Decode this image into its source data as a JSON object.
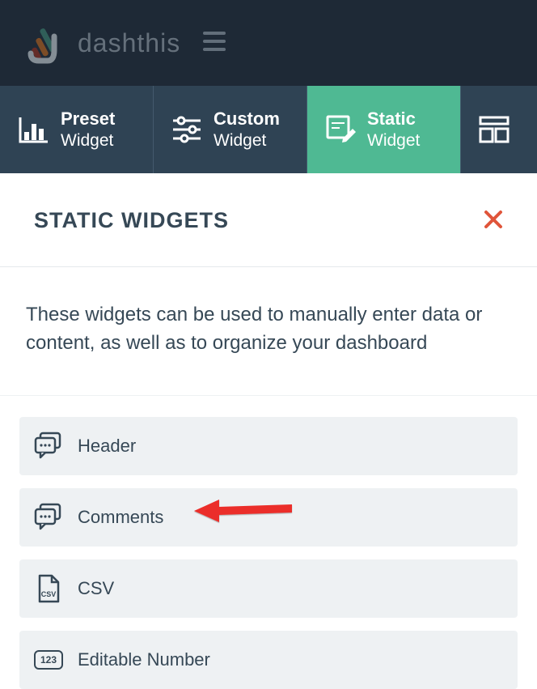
{
  "brand": {
    "name": "dashthis"
  },
  "tabs": [
    {
      "title": "Preset",
      "sub": "Widget"
    },
    {
      "title": "Custom",
      "sub": "Widget"
    },
    {
      "title": "Static",
      "sub": "Widget",
      "active": true
    }
  ],
  "panel": {
    "title": "STATIC WIDGETS",
    "description": "These widgets can be used to manually enter data or content, as well as to organize your dashboard"
  },
  "widgets": [
    {
      "label": "Header",
      "icon": "comment"
    },
    {
      "label": "Comments",
      "icon": "comment"
    },
    {
      "label": "CSV",
      "icon": "csv"
    },
    {
      "label": "Editable Number",
      "icon": "number"
    }
  ]
}
